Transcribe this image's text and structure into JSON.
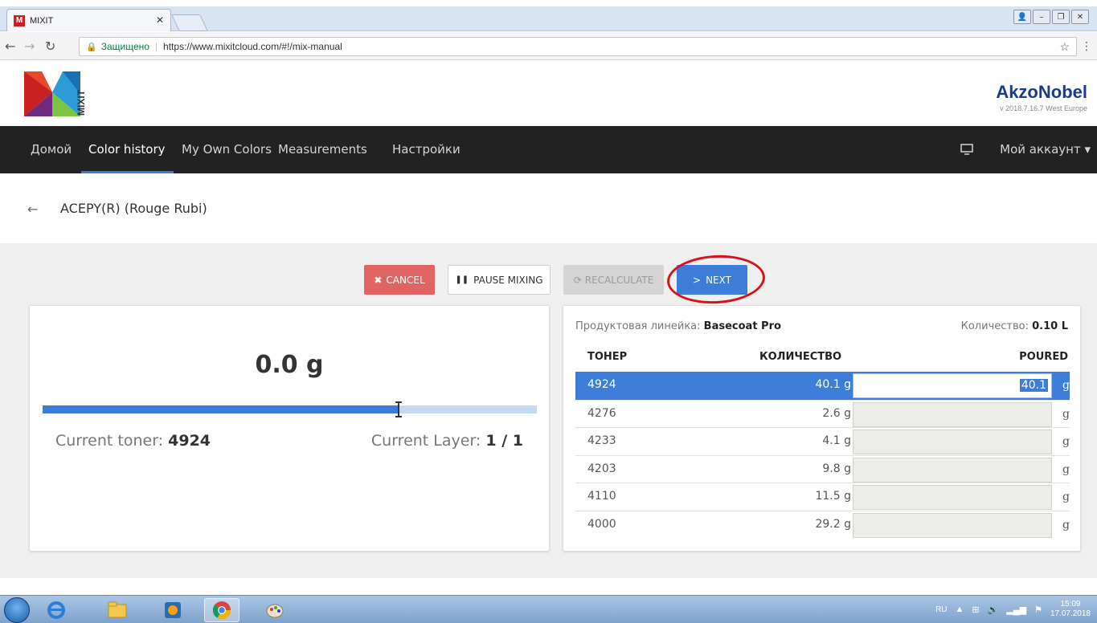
{
  "browser": {
    "tab_title": "MIXIT",
    "tab_favicon": "M",
    "secure_label": "Защищено",
    "url": "https://www.mixitcloud.com/#!/mix-manual"
  },
  "header": {
    "logo_text": "MIXIT",
    "brand": "AkzoNobel",
    "version": "v 2018.7.16.7 West Europe"
  },
  "nav": {
    "items": [
      {
        "label": "Домой"
      },
      {
        "label": "Color history"
      },
      {
        "label": "My Own Colors"
      },
      {
        "label": "Measurements"
      },
      {
        "label": "Настройки"
      }
    ],
    "active_index": 1,
    "account_label": "Мой аккаунт"
  },
  "page": {
    "title": "ACEPY(R) (Rouge Rubi)"
  },
  "toolbar": {
    "cancel_label": "CANCEL",
    "pause_label": "PAUSE MIXING",
    "recalculate_label": "RECALCULATE",
    "next_label": "NEXT"
  },
  "scale": {
    "amount": "0.0 g",
    "progress_fraction": 0.72,
    "current_toner_label": "Current toner:",
    "current_toner": "4924",
    "current_layer_label": "Current Layer:",
    "current_layer": "1 / 1"
  },
  "recipe": {
    "product_line_label": "Продуктовая линейка:",
    "product_line": "Basecoat Pro",
    "quantity_label": "Количество:",
    "quantity": "0.10 L",
    "columns": {
      "toner": "ТОНЕР",
      "amount": "КОЛИЧЕСТВО",
      "poured": "POURED"
    },
    "unit": "g",
    "rows": [
      {
        "toner": "4924",
        "amount": "40.1 g",
        "poured": "40.1"
      },
      {
        "toner": "4276",
        "amount": "2.6 g",
        "poured": ""
      },
      {
        "toner": "4233",
        "amount": "4.1 g",
        "poured": ""
      },
      {
        "toner": "4203",
        "amount": "9.8 g",
        "poured": ""
      },
      {
        "toner": "4110",
        "amount": "11.5 g",
        "poured": ""
      },
      {
        "toner": "4000",
        "amount": "29.2 g",
        "poured": ""
      }
    ],
    "active_row": 0
  },
  "taskbar": {
    "language": "RU",
    "time": "15:09",
    "date": "17.07.2018"
  },
  "colors": {
    "accent": "#3b7dd8",
    "cancel": "#e06464",
    "navbar": "#222222",
    "highlight": "#d8121b"
  }
}
